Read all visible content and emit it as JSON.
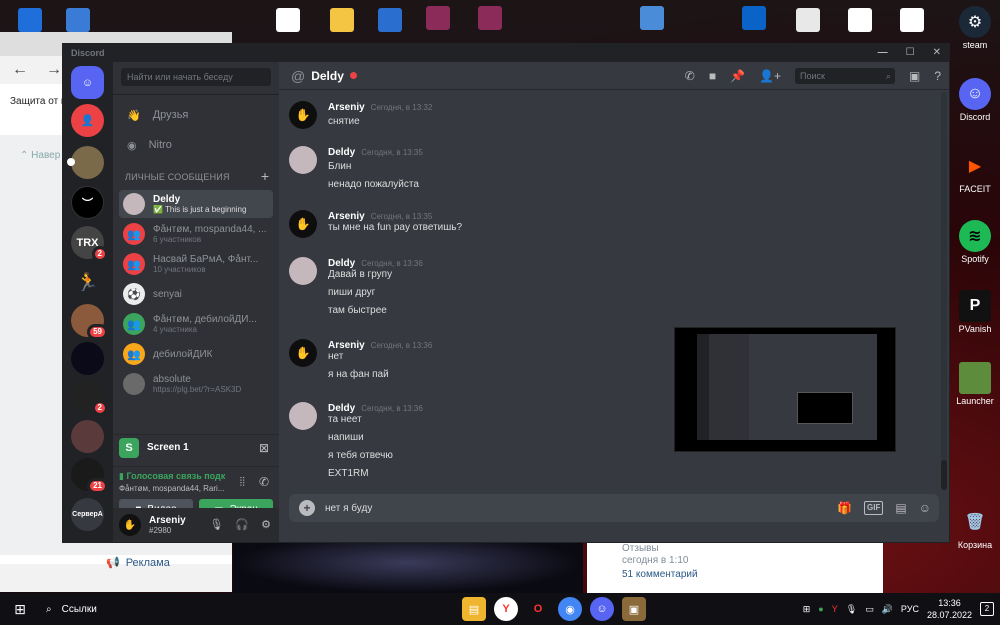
{
  "window": {
    "app_title": "Discord"
  },
  "browser": {
    "page_text": "Защита от в",
    "side_nav": "Навер",
    "ad_link": "Реклама"
  },
  "feed": {
    "reviews": "Отзывы",
    "time": "сегодня в 1:10",
    "comments": "51 комментарий"
  },
  "desktop_icons": [
    {
      "label": "steam",
      "icon": "steam-icon",
      "color": "#1b2838"
    },
    {
      "label": "Discord",
      "icon": "discord-icon",
      "color": "#5865f2"
    },
    {
      "label": "FACEIT",
      "icon": "faceit-icon",
      "color": "#ff5500"
    },
    {
      "label": "Spotify",
      "icon": "spotify-icon",
      "color": "#1db954"
    },
    {
      "label": "PVanish",
      "icon": "pvanish-icon",
      "color": "#111111"
    },
    {
      "label": "Launcher",
      "icon": "minecraft-icon",
      "color": "#5d8c3c"
    },
    {
      "label": "Корзина",
      "icon": "recycle-bin-icon",
      "color": "#7aa7c7"
    }
  ],
  "servers": [
    {
      "name": "home",
      "color": "#5865f2"
    },
    {
      "name": "friends-requests",
      "color": "#ed4245"
    },
    {
      "name": "server-1",
      "color": "#7a6a4a"
    },
    {
      "name": "server-2",
      "color": "#000000"
    },
    {
      "name": "server-3",
      "color": "#333333",
      "badge": "2"
    },
    {
      "name": "server-4",
      "color": "#1a3c5a"
    },
    {
      "name": "server-5",
      "color": "#8b5a3c",
      "badge": "59"
    },
    {
      "name": "server-6",
      "color": "#0a0a18"
    },
    {
      "name": "server-7",
      "color": "#222222",
      "badge": "2"
    },
    {
      "name": "server-8",
      "color": "#5a3a3a"
    },
    {
      "name": "server-9",
      "color": "#1a1a1a",
      "badge": "21"
    },
    {
      "name": "СерверА",
      "color": "#36393f",
      "label": "СерверА"
    }
  ],
  "sidebar": {
    "search_placeholder": "Найти или начать беседу",
    "friends": "Друзья",
    "nitro": "Nitro",
    "section_title": "ЛИЧНЫЕ СООБЩЕНИЯ",
    "dms": [
      {
        "name": "Deldy",
        "sub": "✅ This is just a beginning",
        "color": "#c5b8bd",
        "active": true
      },
      {
        "name": "Фåнтøм, mospanda44, ...",
        "sub": "6 участников",
        "color": "#ed4245"
      },
      {
        "name": "Насвай БаРмА, Фåнт...",
        "sub": "10 участников",
        "color": "#ed4245"
      },
      {
        "name": "senyai",
        "sub": "",
        "color": "#ececec"
      },
      {
        "name": "Фåнтøм, дебилойДИ...",
        "sub": "4 участника",
        "color": "#3ba55d"
      },
      {
        "name": "дебилойДИК",
        "sub": "",
        "color": "#faa61a"
      },
      {
        "name": "absolute",
        "sub": "https://plg.bet/?r=ASK3D",
        "color": "#6a6a6a"
      }
    ],
    "screen_share": "Screen 1",
    "voice_status": "Голосовая связь подк",
    "voice_channel": "Фåнтøм, mospanda44, Rari...",
    "video_button": "Видео",
    "screen_button": "Экран",
    "user": {
      "name": "Arseniy",
      "tag": "#2980"
    }
  },
  "chat": {
    "title": "Deldy",
    "search_placeholder": "Поиск",
    "messages": [
      {
        "author": "Arseniy",
        "time": "Сегодня, в 13:32",
        "lines": [
          "снятие"
        ],
        "avatar": "dark"
      },
      {
        "author": "Deldy",
        "time": "Сегодня, в 13:35",
        "lines": [
          "Блин",
          "ненадо пожалуйста"
        ],
        "avatar": "light"
      },
      {
        "author": "Arseniy",
        "time": "Сегодня, в 13:35",
        "lines": [
          "ты мне  на fun pay ответишь?"
        ],
        "avatar": "dark"
      },
      {
        "author": "Deldy",
        "time": "Сегодня, в 13:36",
        "lines": [
          "Давай в групу",
          "пиши друг",
          "там быстрее"
        ],
        "avatar": "light"
      },
      {
        "author": "Arseniy",
        "time": "Сегодня, в 13:36",
        "lines": [
          "нет",
          "я на фан пай"
        ],
        "avatar": "dark"
      },
      {
        "author": "Deldy",
        "time": "Сегодня, в 13:36",
        "lines": [
          "та неет",
          "напиши",
          "я тебя отвечю",
          "EXT1RM"
        ],
        "avatar": "light"
      }
    ],
    "composer_value": "нет я буду"
  },
  "taskbar": {
    "search": "Ссылки",
    "lang": "РУС",
    "time": "13:36",
    "date": "28.07.2022",
    "notifications": "2"
  }
}
